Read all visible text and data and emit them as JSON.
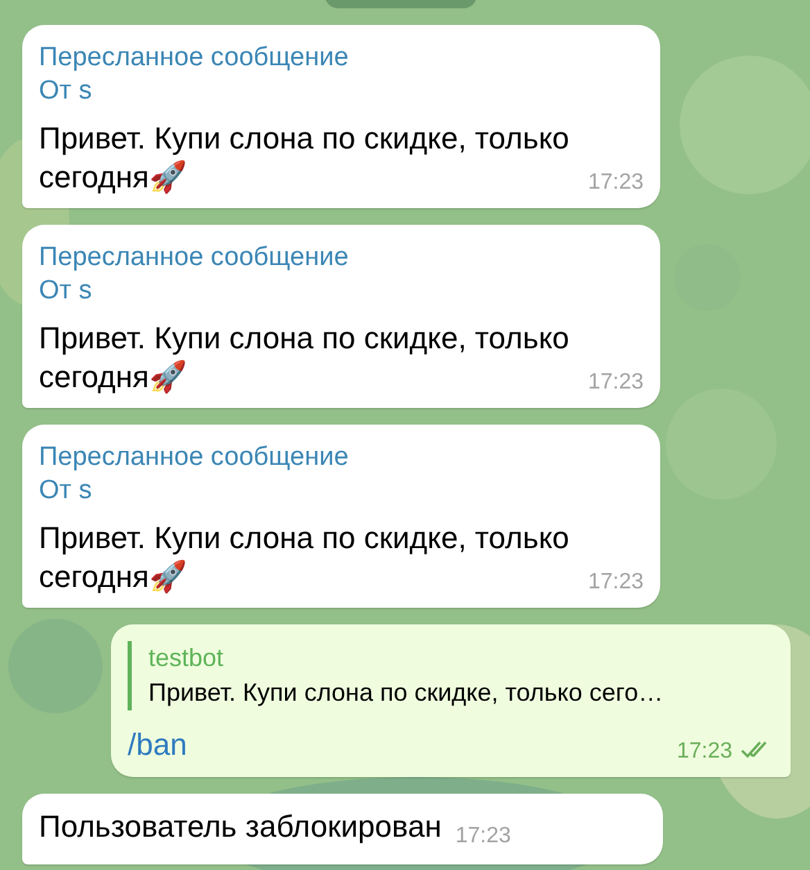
{
  "messages": [
    {
      "kind": "forwarded",
      "outgoing": false,
      "forward_label": "Пересланное сообщение",
      "forward_from": "От s",
      "text": "Привет. Купи слона по скидке, только сегодня🚀",
      "time": "17:23"
    },
    {
      "kind": "forwarded",
      "outgoing": false,
      "forward_label": "Пересланное сообщение",
      "forward_from": "От s",
      "text": "Привет. Купи слона по скидке, только сегодня🚀",
      "time": "17:23"
    },
    {
      "kind": "forwarded",
      "outgoing": false,
      "forward_label": "Пересланное сообщение",
      "forward_from": "От s",
      "text": "Привет. Купи слона по скидке, только сегодня🚀",
      "time": "17:23"
    },
    {
      "kind": "reply",
      "outgoing": true,
      "reply_author": "testbot",
      "reply_text": "Привет. Купи слона по скидке, только сего…",
      "command": "/ban",
      "time": "17:23",
      "read": true
    },
    {
      "kind": "plain",
      "outgoing": false,
      "text": "Пользователь заблокирован",
      "time": "17:23"
    }
  ]
}
